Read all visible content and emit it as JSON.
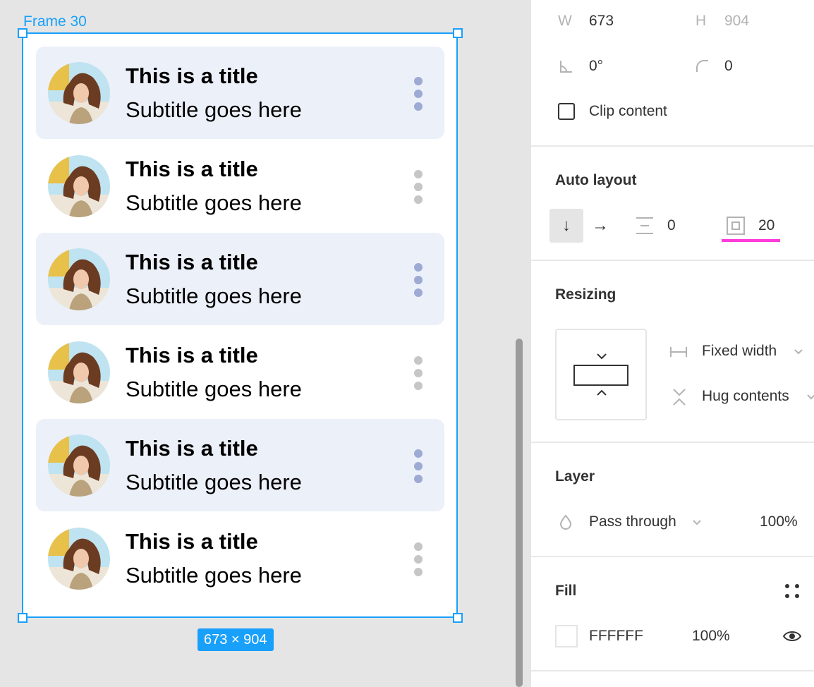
{
  "canvas": {
    "frame_name": "Frame 30",
    "size_badge": "673 × 904",
    "items": [
      {
        "title": "This is a title",
        "subtitle": "Subtitle goes here",
        "shaded": true
      },
      {
        "title": "This is a title",
        "subtitle": "Subtitle goes here",
        "shaded": false
      },
      {
        "title": "This is a title",
        "subtitle": "Subtitle goes here",
        "shaded": true
      },
      {
        "title": "This is a title",
        "subtitle": "Subtitle goes here",
        "shaded": false
      },
      {
        "title": "This is a title",
        "subtitle": "Subtitle goes here",
        "shaded": true
      },
      {
        "title": "This is a title",
        "subtitle": "Subtitle goes here",
        "shaded": false
      }
    ]
  },
  "panel": {
    "dimensions": {
      "w_label": "W",
      "w_value": "673",
      "h_label": "H",
      "h_value": "904",
      "rotation": "0°",
      "radius": "0",
      "clip_content": "Clip content"
    },
    "auto_layout": {
      "title": "Auto layout",
      "spacing": "0",
      "padding": "20"
    },
    "resizing": {
      "title": "Resizing",
      "width_mode": "Fixed width",
      "height_mode": "Hug contents"
    },
    "layer": {
      "title": "Layer",
      "blend": "Pass through",
      "opacity": "100%"
    },
    "fill": {
      "title": "Fill",
      "hex": "FFFFFF",
      "opacity": "100%"
    }
  },
  "colors": {
    "selection": "#18a0fb",
    "item_shade": "#ecf0f9",
    "kebab_active": "#9caad4",
    "kebab_inactive": "#c6c6c6",
    "highlight": "#ff3bdc"
  }
}
